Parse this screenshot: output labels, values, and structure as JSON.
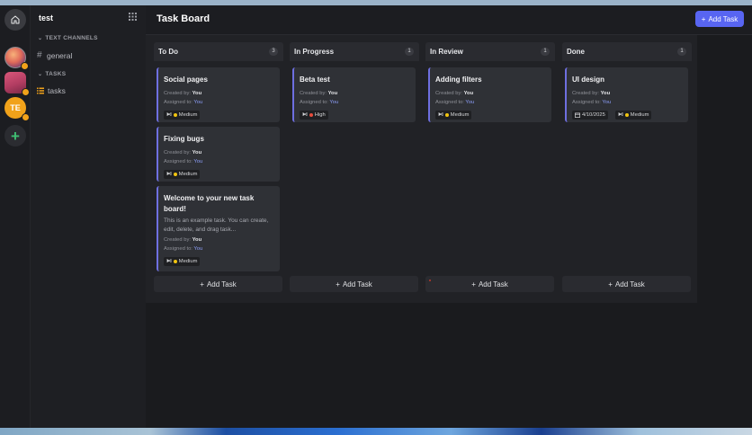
{
  "server": {
    "name": "test",
    "abbr": "TE"
  },
  "sidebar": {
    "sections": [
      {
        "title": "TEXT CHANNELS",
        "items": [
          {
            "prefix": "#",
            "label": "general"
          }
        ]
      },
      {
        "title": "TASKS",
        "items": [
          {
            "label": "tasks"
          }
        ]
      }
    ]
  },
  "header": {
    "title": "Task Board",
    "add_task": "Add Task"
  },
  "colors": {
    "accent": "#5865f2",
    "medium": "#f1c40f",
    "high": "#e74c3c",
    "card_border": "#6e6fe0"
  },
  "columns": [
    {
      "title": "To Do",
      "count": "3",
      "add_label": "Add Task",
      "cards": [
        {
          "title": "Social pages",
          "created_label": "Created by:",
          "created_by": "You",
          "assigned_label": "Assigned to:",
          "assigned_to": "You",
          "priority": "Medium"
        },
        {
          "title": "Fixing bugs",
          "created_label": "Created by:",
          "created_by": "You",
          "assigned_label": "Assigned to:",
          "assigned_to": "You",
          "priority": "Medium"
        },
        {
          "title": "Welcome to your new task board!",
          "description": "This is an example task. You can create, edit, delete, and drag task...",
          "created_label": "Created by:",
          "created_by": "You",
          "assigned_label": "Assigned to:",
          "assigned_to": "You",
          "priority": "Medium"
        }
      ]
    },
    {
      "title": "In Progress",
      "count": "1",
      "add_label": "Add Task",
      "cards": [
        {
          "title": "Beta test",
          "created_label": "Created by:",
          "created_by": "You",
          "assigned_label": "Assigned to:",
          "assigned_to": "You",
          "priority": "High"
        }
      ]
    },
    {
      "title": "In Review",
      "count": "1",
      "add_label": "Add Task",
      "cards": [
        {
          "title": "Adding filters",
          "created_label": "Created by:",
          "created_by": "You",
          "assigned_label": "Assigned to:",
          "assigned_to": "You",
          "priority": "Medium"
        }
      ]
    },
    {
      "title": "Done",
      "count": "1",
      "add_label": "Add Task",
      "cards": [
        {
          "title": "UI design",
          "created_label": "Created by:",
          "created_by": "You",
          "assigned_label": "Assigned to:",
          "assigned_to": "You",
          "due_date": "4/10/2025",
          "priority": "Medium"
        }
      ]
    }
  ]
}
